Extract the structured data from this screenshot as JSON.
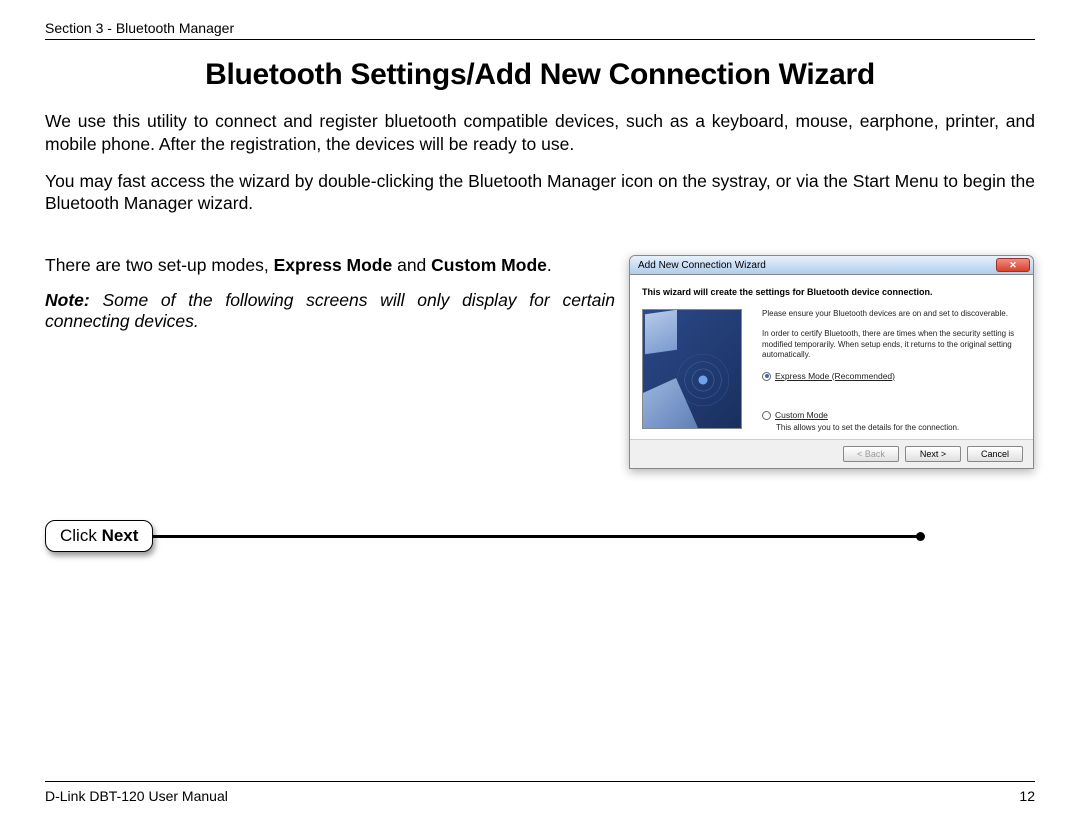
{
  "header": {
    "section": "Section 3 - Bluetooth Manager"
  },
  "title": "Bluetooth Settings/Add New Connection Wizard",
  "para1": "We use this utility to connect and register bluetooth compatible devices, such as a keyboard, mouse, earphone, printer, and mobile phone. After the registration, the devices will be ready to use.",
  "para2": "You may fast access the wizard by double-clicking the Bluetooth Manager icon on the systray, or via the Start Menu to begin the Bluetooth Manager wizard.",
  "modes": {
    "pre": "There are two set-up modes, ",
    "b1": "Express Mode",
    "mid": " and ",
    "b2": "Custom Mode",
    "post": "."
  },
  "note": {
    "label": "Note:",
    "text": " Some of the following screens will only display for certain connecting devices."
  },
  "callout": {
    "pre": "Click ",
    "bold": "Next"
  },
  "wizard": {
    "title": "Add New Connection Wizard",
    "intro": "This wizard will create the settings for Bluetooth device connection.",
    "ensure": "Please ensure your Bluetooth devices are on and set to discoverable.",
    "certify": "In order to certify Bluetooth, there are times when the security setting is modified temporarily. When setup ends, it returns to the original setting automatically.",
    "express_label": "Express Mode (Recommended)",
    "custom_label": "Custom Mode",
    "custom_desc": "This allows you to set the details for the connection.",
    "btn_back": "< Back",
    "btn_next": "Next >",
    "btn_cancel": "Cancel"
  },
  "footer": {
    "left": "D-Link DBT-120 User Manual",
    "right": "12"
  }
}
